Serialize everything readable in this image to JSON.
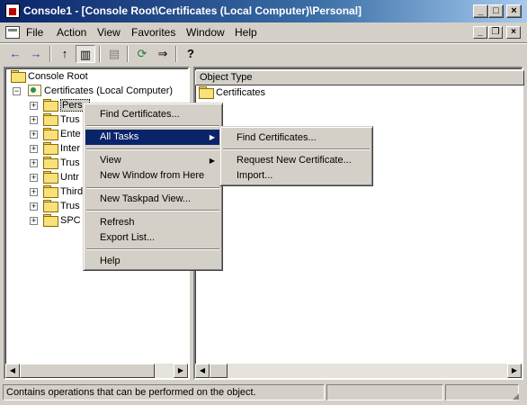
{
  "window": {
    "title": "Console1 - [Console Root\\Certificates (Local Computer)\\Personal]",
    "minimize": "_",
    "maximize": "□",
    "close": "×"
  },
  "menubar": {
    "items": [
      "File",
      "Action",
      "View",
      "Favorites",
      "Window",
      "Help"
    ],
    "mdi_minimize": "_",
    "mdi_restore": "❐",
    "mdi_close": "×"
  },
  "toolbar": {
    "back": "←",
    "forward": "→",
    "up": "↑",
    "show_hide_tree": "▥",
    "delete": "▤",
    "refresh": "⟳",
    "export": "⇒",
    "help": "?"
  },
  "tree": {
    "root": "Console Root",
    "certificates": "Certificates (Local Computer)",
    "children": [
      "Personal",
      "Trusted Root Certification Authorities",
      "Enterprise Trust",
      "Intermediate Certification Authorities",
      "Trusted Publishers",
      "Untrusted Certificates",
      "Third-Party Root Certification Authorities",
      "Trusted People",
      "SPC"
    ],
    "children_visible": [
      "Perso",
      "Trus",
      "Ente",
      "Inter",
      "Trus",
      "Untr",
      "Third",
      "Trus",
      "SPC"
    ]
  },
  "list": {
    "column_header": "Object Type",
    "items": [
      "Certificates"
    ]
  },
  "context_menu": {
    "items": [
      {
        "label": "Find Certificates..."
      },
      {
        "label": "All Tasks",
        "submenu": true
      },
      {
        "label": "View",
        "submenu": true
      },
      {
        "label": "New Window from Here"
      },
      {
        "label": "New Taskpad View..."
      },
      {
        "label": "Refresh"
      },
      {
        "label": "Export List..."
      },
      {
        "label": "Help"
      }
    ],
    "selected": "All Tasks"
  },
  "submenu": {
    "items": [
      "Find Certificates...",
      "Request New Certificate...",
      "Import..."
    ]
  },
  "statusbar": {
    "text": "Contains operations that can be performed on the object."
  },
  "colors": {
    "title_active": "#0a246a",
    "face": "#d4d0c8",
    "highlight": "#0a246a"
  }
}
